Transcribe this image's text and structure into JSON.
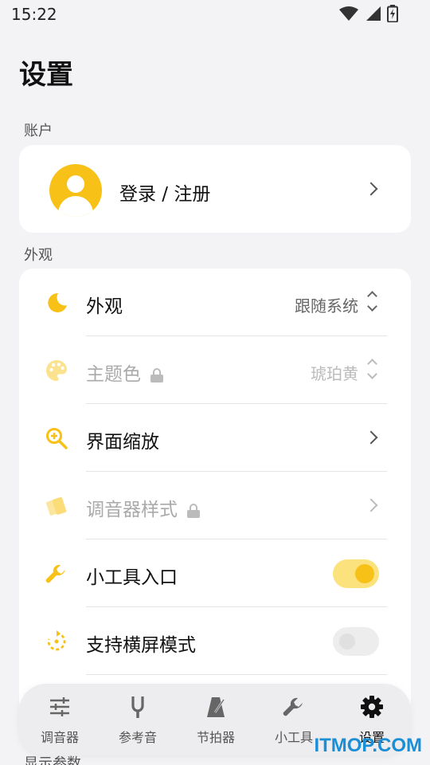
{
  "status_bar": {
    "time": "15:22"
  },
  "page": {
    "title": "设置"
  },
  "sections": {
    "account": "账户",
    "appearance": "外观",
    "display": "显示参数"
  },
  "account": {
    "label": "登录 / 注册"
  },
  "settings": {
    "appearance": {
      "label": "外观",
      "value": "跟随系统",
      "icon": "moon-icon"
    },
    "theme_color": {
      "label": "主题色",
      "value": "琥珀黄",
      "icon": "palette-icon",
      "locked": true
    },
    "ui_scale": {
      "label": "界面缩放",
      "icon": "zoom-in-icon"
    },
    "tuner_style": {
      "label": "调音器样式",
      "icon": "cards-icon",
      "locked": true
    },
    "tools_entry": {
      "label": "小工具入口",
      "icon": "wrench-icon",
      "enabled": true
    },
    "landscape": {
      "label": "支持横屏模式",
      "icon": "rotate-icon",
      "enabled": false
    }
  },
  "nav": {
    "items": [
      {
        "label": "调音器",
        "icon": "sliders-icon"
      },
      {
        "label": "参考音",
        "icon": "tuning-fork-icon"
      },
      {
        "label": "节拍器",
        "icon": "metronome-icon"
      },
      {
        "label": "小工具",
        "icon": "wrench-icon"
      },
      {
        "label": "设置",
        "icon": "gear-icon",
        "active": true
      }
    ]
  },
  "watermark": "ITMOP.COM",
  "colors": {
    "accent": "#f7c118",
    "accent_light": "#fbe27d",
    "background": "#f3f3f6",
    "card": "#ffffff"
  }
}
